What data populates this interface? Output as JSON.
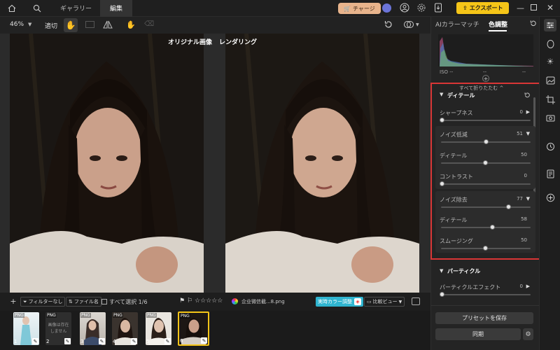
{
  "titlebar": {
    "tabs": [
      {
        "label": "ギャラリー"
      },
      {
        "label": "編集"
      }
    ],
    "charge_label": "チャージ",
    "export_label": "エクスポート"
  },
  "toolbar": {
    "zoom": "46%",
    "fit_label": "適切"
  },
  "viewer": {
    "original_label": "オリジナル画像",
    "render_label": "レンダリング"
  },
  "panel": {
    "tabs": [
      {
        "label": "AIカラーマッチ"
      },
      {
        "label": "色調整"
      }
    ],
    "histogram": {
      "iso": "ISO --",
      "v1": "--",
      "v2": "--"
    },
    "collapse_all": "すべて折りたたむ ^",
    "detail_section": "ディテール",
    "sliders": [
      {
        "label": "シャープネス",
        "value": "0",
        "fraction": 0.0
      },
      {
        "label": "ノイズ低減",
        "value": "51",
        "fraction": 0.51
      },
      {
        "label": "ディテール",
        "value": "50",
        "fraction": 0.5
      },
      {
        "label": "コントラスト",
        "value": "0",
        "fraction": 0.0
      },
      {
        "label": "ノイズ除去",
        "value": "77",
        "fraction": 0.77
      },
      {
        "label": "ディテール",
        "value": "58",
        "fraction": 0.58
      },
      {
        "label": "スムージング",
        "value": "50",
        "fraction": 0.5
      }
    ],
    "particle_section": "パーティクル",
    "particle_slider": {
      "label": "パーティクルエフェクト",
      "value": "0",
      "fraction": 0.0
    },
    "save_preset": "プリセットを保存",
    "sync": "同期"
  },
  "filterbar": {
    "filter_label": "フィルターなし",
    "filename_label": "ファイル名",
    "select_all_label": "すべて選択 1/6",
    "filename": "企业微信截...8.png",
    "realtime_label": "実時カラー調整",
    "compare_label": "比較ビュー"
  },
  "filmstrip": {
    "thumbs": [
      {
        "format": "PNG",
        "num": "1"
      },
      {
        "format": "PNG",
        "num": "2",
        "missing": "画像は存在しません"
      },
      {
        "format": "PNG",
        "num": "3"
      },
      {
        "format": "PNG",
        "num": "4"
      },
      {
        "format": "PNG",
        "num": "5"
      },
      {
        "format": "PNG",
        "num": "6"
      }
    ]
  }
}
